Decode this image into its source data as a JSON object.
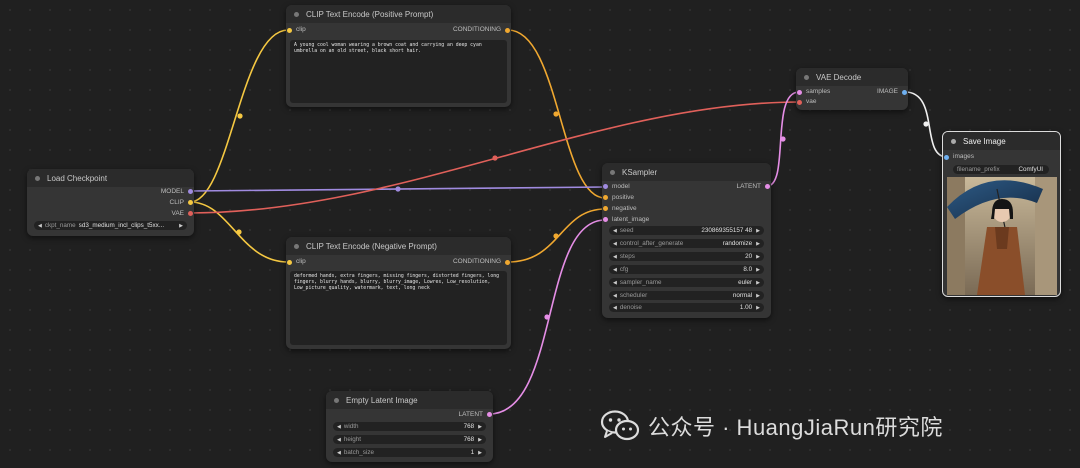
{
  "colors": {
    "clip": "#f5c842",
    "conditioning": "#f0a830",
    "model": "#a08be0",
    "vae": "#e0605a",
    "latent": "#e58ee6",
    "image": "#6fb0f0"
  },
  "nodes": {
    "load_checkpoint": {
      "title": "Load Checkpoint",
      "outputs": [
        "MODEL",
        "CLIP",
        "VAE"
      ],
      "widget": {
        "label": "ckpt_name",
        "value": "sd3_medium_incl_clips_t5xx..."
      }
    },
    "clip_pos": {
      "title": "CLIP Text Encode (Positive Prompt)",
      "input": "clip",
      "output": "CONDITIONING",
      "text": "A young cool woman wearing a brown coat and carrying an deep cyan umbrella on an old street, black short hair."
    },
    "clip_neg": {
      "title": "CLIP Text Encode (Negative Prompt)",
      "input": "clip",
      "output": "CONDITIONING",
      "text": "deformed hands, extra fingers, missing fingers, distorted fingers, long fingers, blurry hands, blurry, blurry_image, Lowres, Low_resolution, Low_picture_quality, watermark, text, long neck"
    },
    "ksampler": {
      "title": "KSampler",
      "inputs": [
        "model",
        "positive",
        "negative",
        "latent_image"
      ],
      "output": "LATENT",
      "widgets": [
        {
          "label": "seed",
          "value": "230869355157 48"
        },
        {
          "label": "control_after_generate",
          "value": "randomize"
        },
        {
          "label": "steps",
          "value": "20"
        },
        {
          "label": "cfg",
          "value": "8.0"
        },
        {
          "label": "sampler_name",
          "value": "euler"
        },
        {
          "label": "scheduler",
          "value": "normal"
        },
        {
          "label": "denoise",
          "value": "1.00"
        }
      ]
    },
    "vae_decode": {
      "title": "VAE Decode",
      "inputs": [
        "samples",
        "vae"
      ],
      "output": "IMAGE"
    },
    "save_image": {
      "title": "Save Image",
      "input": "images",
      "widget": {
        "label": "filename_prefix",
        "value": "ComfyUI"
      }
    },
    "empty_latent": {
      "title": "Empty Latent Image",
      "output": "LATENT",
      "widgets": [
        {
          "label": "width",
          "value": "768"
        },
        {
          "label": "height",
          "value": "768"
        },
        {
          "label": "batch_size",
          "value": "1"
        }
      ]
    }
  },
  "watermark": {
    "text": "公众号 · HuangJiaRun研究院"
  }
}
